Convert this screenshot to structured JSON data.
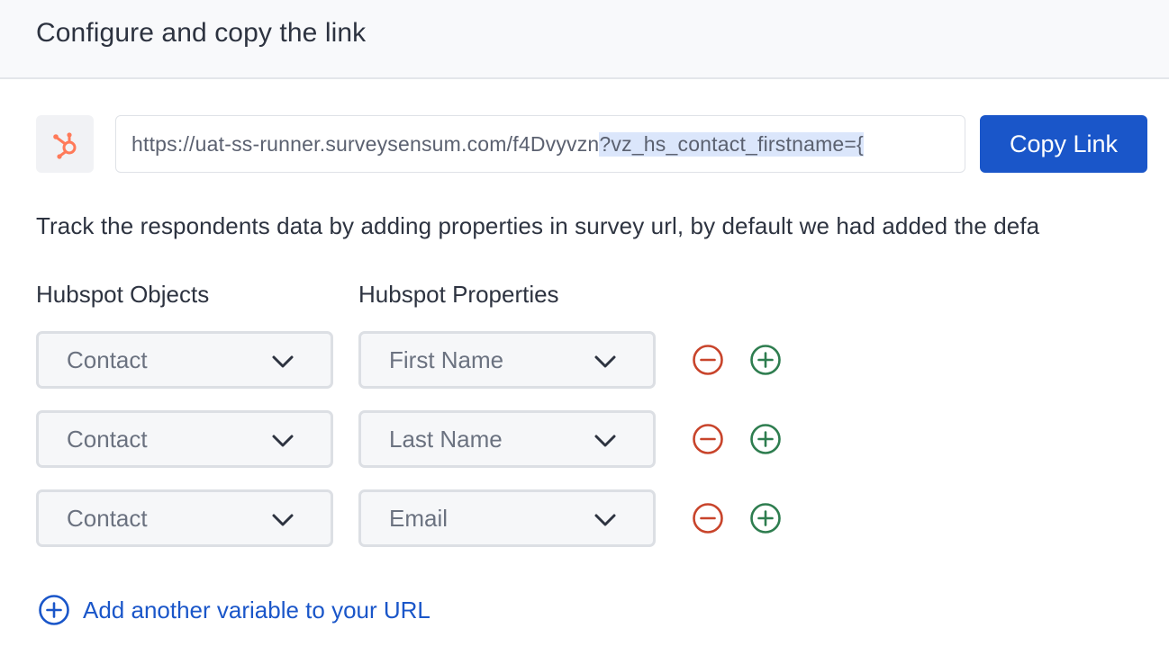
{
  "header": {
    "title": "Configure and copy the link"
  },
  "link": {
    "url_plain": "https://uat-ss-runner.surveysensum.com/f4Dvyvzn",
    "url_selected": "?vz_hs_contact_firstname={",
    "copy_label": "Copy Link",
    "logo_icon": "hubspot-icon"
  },
  "description": "Track the respondents data by adding properties in survey url, by default we had added the defa",
  "columns": {
    "objects": "Hubspot Objects",
    "properties": "Hubspot Properties"
  },
  "rows": [
    {
      "object": "Contact",
      "property": "First Name"
    },
    {
      "object": "Contact",
      "property": "Last Name"
    },
    {
      "object": "Contact",
      "property": "Email"
    }
  ],
  "add_variable": {
    "label": "Add another variable to your URL"
  },
  "colors": {
    "accent": "#1a56c9",
    "remove": "#c8442b",
    "add": "#2e7d4f",
    "hubspot": "#ff7a59"
  }
}
